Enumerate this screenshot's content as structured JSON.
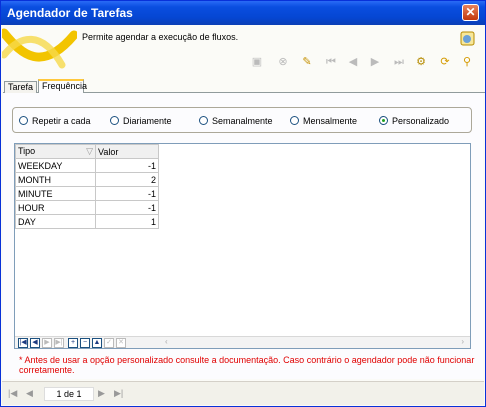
{
  "window": {
    "title": "Agendador de Tarefas",
    "close_label": "✕"
  },
  "header": {
    "description": "Permite agendar a execução de fluxos."
  },
  "toolbar": {
    "icons": [
      "save-icon",
      "cancel-icon",
      "new-record-icon",
      "first-icon",
      "previous-icon",
      "next-icon",
      "last-icon",
      "settings-icon",
      "refresh-icon",
      "search-icon"
    ]
  },
  "tabs": [
    {
      "label": "Tarefa"
    },
    {
      "label": "Frequência",
      "active": true
    }
  ],
  "frequency": {
    "options": [
      {
        "label": "Repetir a cada",
        "checked": false
      },
      {
        "label": "Diariamente",
        "checked": false
      },
      {
        "label": "Semanalmente",
        "checked": false
      },
      {
        "label": "Mensalmente",
        "checked": false
      },
      {
        "label": "Personalizado",
        "checked": true
      }
    ]
  },
  "grid": {
    "columns": [
      "Tipo",
      "Valor"
    ],
    "rows": [
      {
        "tipo": "WEEKDAY",
        "valor": "-1"
      },
      {
        "tipo": "MONTH",
        "valor": "2"
      },
      {
        "tipo": "MINUTE",
        "valor": "-1"
      },
      {
        "tipo": "HOUR",
        "valor": "-1"
      },
      {
        "tipo": "DAY",
        "valor": "1"
      }
    ],
    "nav": {
      "first": "|◀",
      "prev": "◀",
      "next": "▶",
      "last": "▶|",
      "add": "+",
      "remove": "−",
      "up": "▲",
      "apply": "✓",
      "cancel": "✕"
    }
  },
  "note": "* Antes de usar a opção personalizado consulte a documentação. Caso contrário o agendador pode não funcionar corretamente.",
  "pager": {
    "first": "|◀",
    "prev": "◀",
    "page_info": "1 de 1",
    "next": "▶",
    "last": "▶|"
  },
  "colors": {
    "titlebar": "#0546d2",
    "note": "#e00000",
    "radio_checked": "#21a121"
  }
}
